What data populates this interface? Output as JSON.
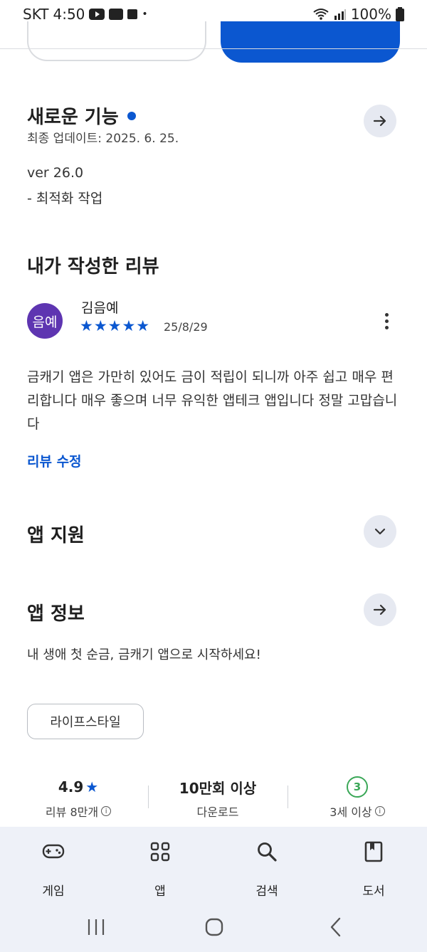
{
  "status_bar": {
    "carrier": "SKT",
    "time": "4:50",
    "battery": "100%"
  },
  "whats_new": {
    "title": "새로운 기능",
    "updated": "최종 업데이트: 2025. 6. 25.",
    "version": "ver 26.0",
    "note": "- 최적화 작업"
  },
  "my_review": {
    "title": "내가 작성한 리뷰",
    "avatar_text": "음예",
    "reviewer": "김음예",
    "rating": 5,
    "stars": "★★★★★",
    "date": "25/8/29",
    "body": "금캐기 앱은 가만히 있어도 금이 적립이 되니까 아주 쉽고 매우 편리합니다 매우 좋으며 너무 유익한 앱테크 앱입니다 정말 고맙습니다",
    "edit_label": "리뷰 수정"
  },
  "app_support": {
    "title": "앱 지원"
  },
  "app_info": {
    "title": "앱 정보",
    "description": "내 생애 첫 순금, 금캐기 앱으로 시작하세요!",
    "category_chip": "라이프스타일"
  },
  "stats": {
    "rating_value": "4.9",
    "rating_label": "리뷰 8만개",
    "downloads_value": "10만회 이상",
    "downloads_label": "다운로드",
    "age_badge": "3",
    "age_label": "3세 이상"
  },
  "bottom_nav": {
    "items": [
      {
        "label": "게임",
        "icon": "gamepad-icon"
      },
      {
        "label": "앱",
        "icon": "apps-grid-icon"
      },
      {
        "label": "검색",
        "icon": "search-icon"
      },
      {
        "label": "도서",
        "icon": "book-icon"
      }
    ]
  },
  "colors": {
    "accent": "#0b57d0",
    "avatar_bg": "#5e35b1",
    "age_green": "#3aa757",
    "nav_bg": "#eef1f8"
  }
}
